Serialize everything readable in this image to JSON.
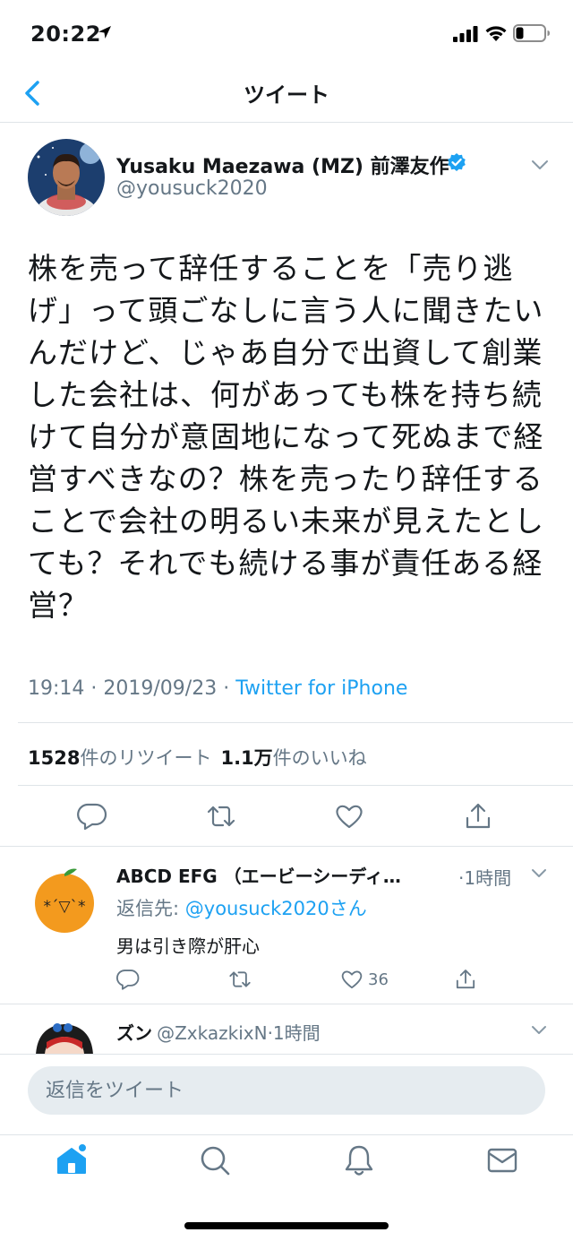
{
  "status_bar": {
    "time": "20:22"
  },
  "nav": {
    "title": "ツイート"
  },
  "tweet": {
    "author_name": "Yusaku Maezawa (MZ) 前澤友作",
    "handle": "@yousuck2020",
    "text": "株を売って辞任することを「売り逃げ」って頭ごなしに言う人に聞きたいんだけど、じゃあ自分で出資して創業した会社は、何があっても株を持ち続けて自分が意固地になって死ぬまで経営すべきなの？株を売ったり辞任することで会社の明るい未来が見えたとしても？それでも続ける事が責任ある経営？",
    "time": "19:14",
    "date": "2019/09/23",
    "separator": " · ",
    "source": "Twitter for iPhone",
    "retweet_count": "1528",
    "retweet_label": "件のリツイート",
    "like_count": "1.1万",
    "like_label": "件のいいね"
  },
  "replies": [
    {
      "name": "ABCD EFG （エービーシーディ…",
      "time": "·1時間",
      "reply_to_prefix": "返信先: ",
      "reply_to_handle": "@yousuck2020さん",
      "text": "男は引き際が肝心",
      "like_count": "36"
    },
    {
      "name": "ズン",
      "handle": "@ZxkazkixN",
      "time": "·1時間"
    }
  ],
  "compose": {
    "placeholder": "返信をツイート"
  },
  "icons": {
    "location": "location-arrow-icon",
    "signal": "cellular-signal-icon",
    "wifi": "wifi-icon",
    "battery": "battery-icon",
    "back": "chevron-left-icon",
    "verified": "verified-badge-icon",
    "more": "chevron-down-icon",
    "reply": "reply-icon",
    "retweet": "retweet-icon",
    "like": "heart-icon",
    "share": "share-icon",
    "home": "home-icon",
    "search": "search-icon",
    "notifications": "bell-icon",
    "messages": "mail-icon"
  },
  "colors": {
    "accent": "#1da1f2",
    "text": "#14171a",
    "secondary": "#657786",
    "divider": "#dfe4e8",
    "input_bg": "#e6ecf0"
  }
}
